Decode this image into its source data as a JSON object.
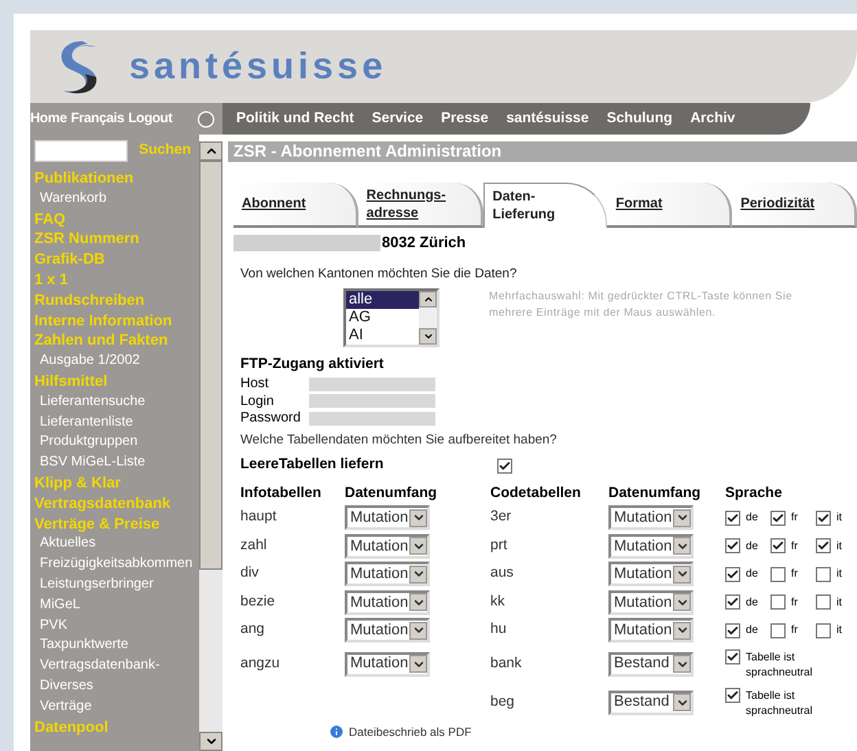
{
  "header": {
    "logo_text": "santésuisse"
  },
  "nav": {
    "left_links": [
      "Home",
      "Français",
      "Logout"
    ],
    "main_links": [
      "Politik und Recht",
      "Service",
      "Presse",
      "santésuisse",
      "Schulung",
      "Archiv"
    ]
  },
  "search": {
    "button": "Suchen"
  },
  "sidebar": {
    "items": [
      {
        "label": "Publikationen",
        "children": [
          {
            "label": "Warenkorb"
          }
        ]
      },
      {
        "label": "FAQ"
      },
      {
        "label": "ZSR Nummern"
      },
      {
        "label": "Grafik-DB"
      },
      {
        "label": "1 x 1"
      },
      {
        "label": "Rundschreiben"
      },
      {
        "label": "Interne Information"
      },
      {
        "label": "Zahlen und Fakten",
        "children": [
          {
            "label": "Ausgabe 1/2002"
          }
        ]
      },
      {
        "label": "Hilfsmittel",
        "children": [
          {
            "label": "Lieferantensuche"
          },
          {
            "label": "Lieferantenliste"
          },
          {
            "label": "Produktgruppen"
          },
          {
            "label": "BSV MiGeL-Liste"
          }
        ]
      },
      {
        "label": "Klipp & Klar"
      },
      {
        "label": "Vertragsdatenbank"
      },
      {
        "label": "Verträge & Preise",
        "children": [
          {
            "label": "Aktuelles"
          },
          {
            "label": "Freizügigkeitsabkommen"
          },
          {
            "label": "Leistungserbringer"
          },
          {
            "label": "MiGeL"
          },
          {
            "label": "PVK"
          },
          {
            "label": "Taxpunktwerte"
          },
          {
            "label": "Vertragsdatenbank-\nDiverses"
          },
          {
            "label": "Verträge"
          }
        ]
      },
      {
        "label": "Datenpool"
      }
    ]
  },
  "title": "ZSR - Abonnement Administration",
  "tabs": [
    {
      "label": "Abonnent",
      "selected": false
    },
    {
      "label": "Rechnungs-\nadresse",
      "selected": false
    },
    {
      "label": "Daten-\nLieferung",
      "selected": true
    },
    {
      "label": "Format",
      "selected": false
    },
    {
      "label": "Periodizität",
      "selected": false
    }
  ],
  "address": "8032 Zürich",
  "kanton_question": "Von welchen Kantonen möchten Sie die Daten?",
  "kantons": [
    {
      "label": "alle",
      "selected": true
    },
    {
      "label": "AG",
      "selected": false
    },
    {
      "label": "AI",
      "selected": false
    }
  ],
  "kanton_hint": "Mehrfachauswahl: Mit gedrückter CTRL-Taste können Sie mehrere Einträge mit der Maus auswählen.",
  "ftp": {
    "title": "FTP-Zugang aktiviert",
    "fields": [
      {
        "label": "Host"
      },
      {
        "label": "Login"
      },
      {
        "label": "Password"
      }
    ]
  },
  "tables_question": "Welche Tabellendaten möchten Sie aufbereitet haben?",
  "empty_tables": {
    "label": "LeereTabellen liefern",
    "checked": true
  },
  "columns": [
    "Infotabellen",
    "Datenumfang",
    "Codetabellen",
    "Datenumfang",
    "Sprache"
  ],
  "rows": [
    {
      "info": "haupt",
      "info_scope": "Mutation",
      "code": "3er",
      "code_scope": "Mutation",
      "kind": "languages",
      "languages": [
        {
          "label": "de",
          "checked": true
        },
        {
          "label": "fr",
          "checked": true
        },
        {
          "label": "it",
          "checked": true
        }
      ]
    },
    {
      "info": "zahl",
      "info_scope": "Mutation",
      "code": "prt",
      "code_scope": "Mutation",
      "kind": "languages",
      "languages": [
        {
          "label": "de",
          "checked": true
        },
        {
          "label": "fr",
          "checked": true
        },
        {
          "label": "it",
          "checked": true
        }
      ]
    },
    {
      "info": "div",
      "info_scope": "Mutation",
      "code": "aus",
      "code_scope": "Mutation",
      "kind": "languages",
      "languages": [
        {
          "label": "de",
          "checked": true
        },
        {
          "label": "fr",
          "checked": false
        },
        {
          "label": "it",
          "checked": false
        }
      ]
    },
    {
      "info": "bezie",
      "info_scope": "Mutation",
      "code": "kk",
      "code_scope": "Mutation",
      "kind": "languages",
      "languages": [
        {
          "label": "de",
          "checked": true
        },
        {
          "label": "fr",
          "checked": false
        },
        {
          "label": "it",
          "checked": false
        }
      ]
    },
    {
      "info": "ang",
      "info_scope": "Mutation",
      "code": "hu",
      "code_scope": "Mutation",
      "kind": "languages",
      "languages": [
        {
          "label": "de",
          "checked": true
        },
        {
          "label": "fr",
          "checked": false
        },
        {
          "label": "it",
          "checked": false
        }
      ]
    },
    {
      "info": "angzu",
      "info_scope": "Mutation",
      "code": "bank",
      "code_scope": "Bestand",
      "kind": "neutral",
      "neutral": {
        "label": "Tabelle ist sprachneutral",
        "checked": true
      }
    },
    {
      "code": "beg",
      "code_scope": "Bestand",
      "kind": "neutral",
      "neutral": {
        "label": "Tabelle ist sprachneutral",
        "checked": true
      }
    }
  ],
  "pdf_link": "Dateibeschrieb als PDF"
}
